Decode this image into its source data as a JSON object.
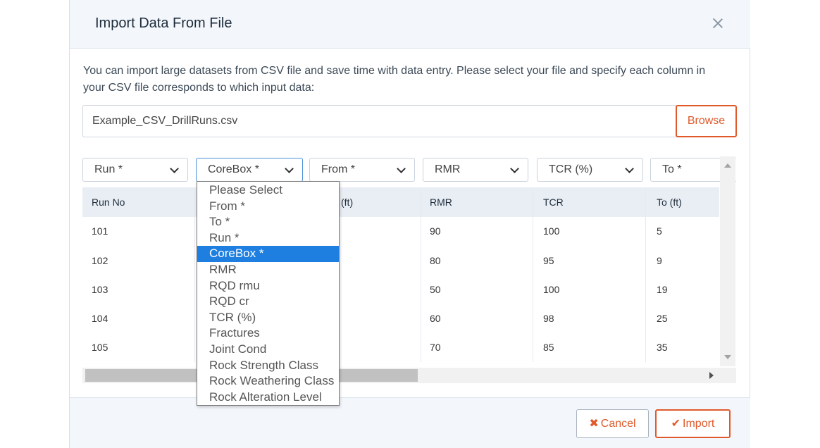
{
  "dialog": {
    "title": "Import Data From File",
    "description": "You can import large datasets from CSV file and save time with data entry. Please select your file and specify each column in your CSV file corresponds to which input data:"
  },
  "file": {
    "value": "Example_CSV_DrillRuns.csv",
    "browse_label": "Browse"
  },
  "column_selects": [
    "Run *",
    "CoreBox *",
    "From *",
    "RMR",
    "TCR (%)",
    "To *"
  ],
  "table": {
    "headers": [
      "Run No",
      "",
      "(ft)",
      "RMR",
      "TCR",
      "To (ft)"
    ],
    "rows": [
      {
        "run": "101",
        "rmr": "90",
        "tcr": "100",
        "to": "5"
      },
      {
        "run": "102",
        "rmr": "80",
        "tcr": "95",
        "to": "9"
      },
      {
        "run": "103",
        "rmr": "50",
        "tcr": "100",
        "to": "19"
      },
      {
        "run": "104",
        "rmr": "60",
        "tcr": "98",
        "to": "25"
      },
      {
        "run": "105",
        "rmr": "70",
        "tcr": "85",
        "to": "35"
      }
    ]
  },
  "dropdown": {
    "selected": "CoreBox *",
    "options": [
      "Please Select",
      "From *",
      "To *",
      "Run *",
      "CoreBox *",
      "RMR",
      "RQD rmu",
      "RQD cr",
      "TCR (%)",
      "Fractures",
      "Joint Cond",
      "Rock Strength Class",
      "Rock Weathering Class",
      "Rock Alteration Level"
    ]
  },
  "footer": {
    "cancel_icon": "✖",
    "cancel_label": "Cancel",
    "import_icon": "✔",
    "import_label": "Import"
  },
  "colors": {
    "accent": "#e0592a",
    "selected_option": "#1e7fe0",
    "header_bg": "#f3f7fc",
    "table_header_bg": "#e9eef4"
  }
}
